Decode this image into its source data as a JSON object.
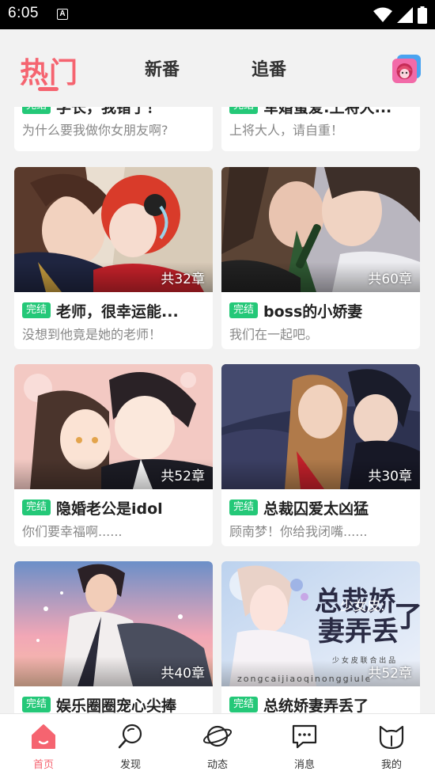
{
  "status_bar": {
    "time": "6:05",
    "notification_letter": "A"
  },
  "top_tabs": [
    {
      "label": "热门",
      "active": true
    },
    {
      "label": "新番",
      "active": false
    },
    {
      "label": "追番",
      "active": false
    }
  ],
  "cards": [
    {
      "badge": "完结",
      "title": "学长，我错了！",
      "desc": "为什么要我做你女朋友啊?",
      "chapters": ""
    },
    {
      "badge": "完结",
      "title": "军婚蜜爱:上将大...",
      "desc": "上将大人，请自重！",
      "chapters": ""
    },
    {
      "badge": "完结",
      "title": "老师，很幸运能...",
      "desc": "没想到他竟是她的老师！",
      "chapters": "共32章"
    },
    {
      "badge": "完结",
      "title": "boss的小娇妻",
      "desc": "我们在一起吧。",
      "chapters": "共60章"
    },
    {
      "badge": "完结",
      "title": "隐婚老公是idol",
      "desc": "你们要幸福啊......",
      "chapters": "共52章"
    },
    {
      "badge": "完结",
      "title": "总裁囚爱太凶猛",
      "desc": "顾南梦！你给我闭嘴......",
      "chapters": "共30章"
    },
    {
      "badge": "完结",
      "title": "娱乐圈圈宠心尖捧",
      "desc": "",
      "chapters": "共40章"
    },
    {
      "badge": "完结",
      "title": "总统娇妻弄丢了",
      "desc": "",
      "chapters": "共52章"
    }
  ],
  "cover_text": {
    "card8_big_line1": "总裁娇",
    "card8_small": "少女皮:",
    "card8_big_line2": "妻弄丢",
    "card8_char": "了",
    "card8_credit": "少 女 皮 联 合 出 品",
    "card8_pinyin": "zongcaijiaoqinonggiule"
  },
  "bottom_nav": [
    {
      "label": "首页",
      "icon": "home-icon",
      "active": true
    },
    {
      "label": "发现",
      "icon": "search-icon",
      "active": false
    },
    {
      "label": "动态",
      "icon": "planet-icon",
      "active": false
    },
    {
      "label": "消息",
      "icon": "message-icon",
      "active": false
    },
    {
      "label": "我的",
      "icon": "profile-icon",
      "active": false
    }
  ],
  "colors": {
    "accent": "#f56470",
    "badge": "#24c878",
    "background": "#f2f2f2"
  }
}
